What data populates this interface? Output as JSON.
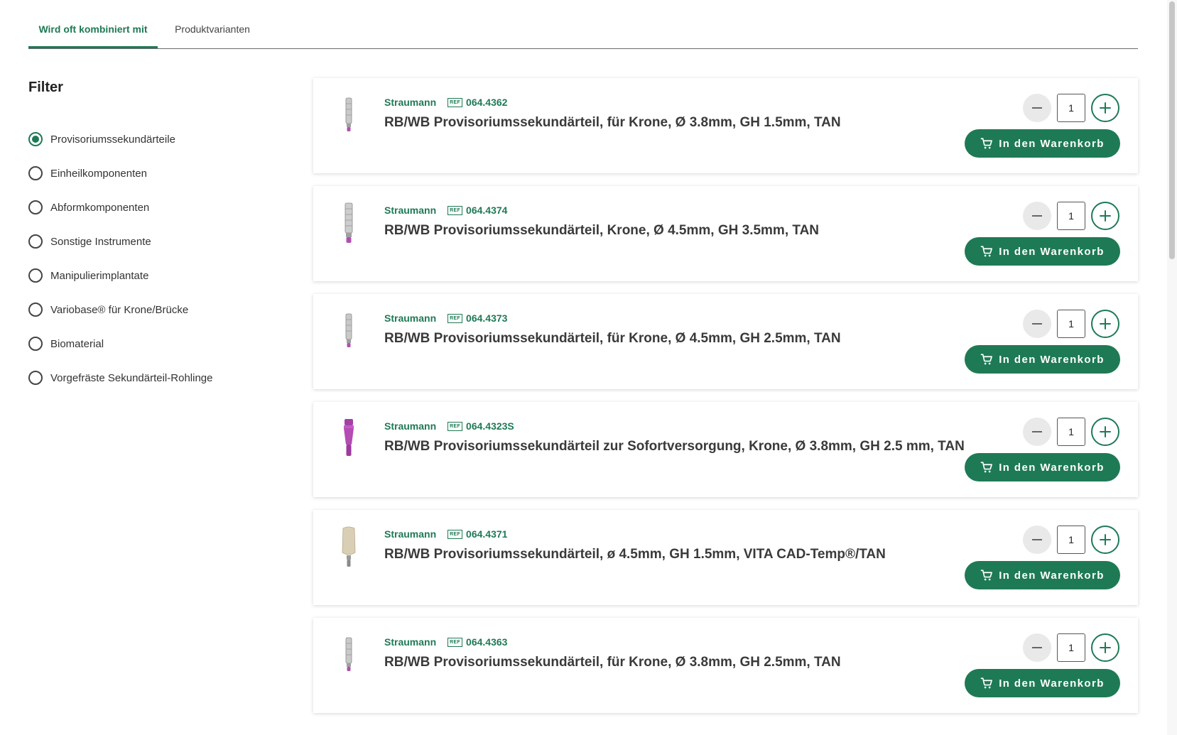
{
  "tabs": [
    {
      "label": "Wird oft kombiniert mit",
      "active": true
    },
    {
      "label": "Produktvarianten",
      "active": false
    }
  ],
  "filter": {
    "title": "Filter",
    "options": [
      {
        "label": "Provisoriumssekundärteile",
        "selected": true
      },
      {
        "label": "Einheilkomponenten",
        "selected": false
      },
      {
        "label": "Abformkomponenten",
        "selected": false
      },
      {
        "label": "Sonstige Instrumente",
        "selected": false
      },
      {
        "label": "Manipulierimplantate",
        "selected": false
      },
      {
        "label": "Variobase® für Krone/Brücke",
        "selected": false
      },
      {
        "label": "Biomaterial",
        "selected": false
      },
      {
        "label": "Vorgefräste Sekundärteil-Rohlinge",
        "selected": false
      }
    ]
  },
  "ref_badge": "REF",
  "cart_label": "In den Warenkorb",
  "products": [
    {
      "brand": "Straumann",
      "ref": "064.4362",
      "title": "RB/WB Provisoriumssekundärteil, für Krone, Ø 3.8mm, GH 1.5mm, TAN",
      "quantity": "1",
      "image": "slim-titanium-abutment"
    },
    {
      "brand": "Straumann",
      "ref": "064.4374",
      "title": "RB/WB Provisoriumssekundärteil, Krone, Ø 4.5mm, GH 3.5mm, TAN",
      "quantity": "1",
      "image": "tall-titanium-abutment"
    },
    {
      "brand": "Straumann",
      "ref": "064.4373",
      "title": "RB/WB Provisoriumssekundärteil, für Krone, Ø 4.5mm, GH 2.5mm, TAN",
      "quantity": "1",
      "image": "slim-titanium-abutment"
    },
    {
      "brand": "Straumann",
      "ref": "064.4323S",
      "title": "RB/WB Provisoriumssekundärteil zur Sofortversorgung, Krone, Ø 3.8mm, GH 2.5 mm, TAN",
      "quantity": "1",
      "image": "magenta-abutment"
    },
    {
      "brand": "Straumann",
      "ref": "064.4371",
      "title": "RB/WB Provisoriumssekundärteil, ø 4.5mm, GH 1.5mm, VITA CAD-Temp®/TAN",
      "quantity": "1",
      "image": "beige-cad-temp-abutment"
    },
    {
      "brand": "Straumann",
      "ref": "064.4363",
      "title": "RB/WB Provisoriumssekundärteil, für Krone, Ø 3.8mm, GH 2.5mm, TAN",
      "quantity": "1",
      "image": "slim-titanium-abutment"
    }
  ],
  "colors": {
    "accent": "#1e7a55",
    "text": "#3a3a3a",
    "background": "#ffffff"
  }
}
